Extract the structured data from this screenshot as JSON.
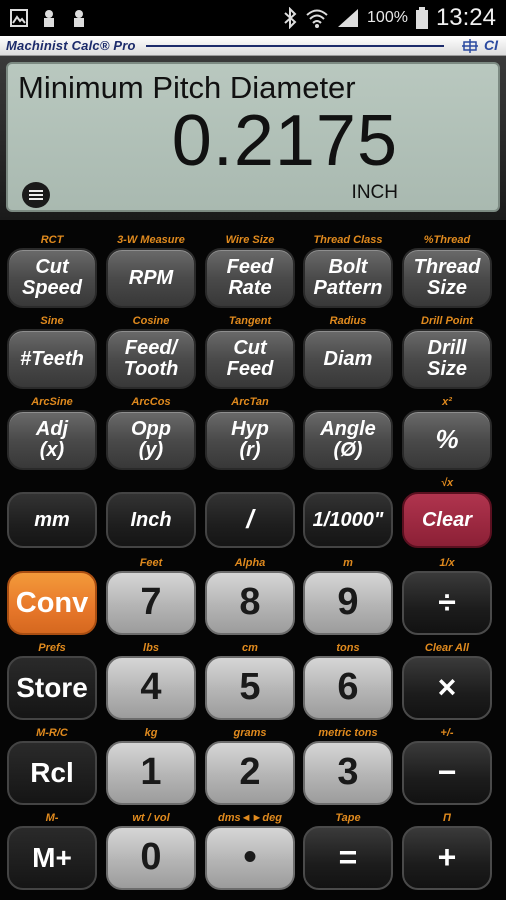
{
  "status_bar": {
    "battery_pct": "100%",
    "time": "13:24"
  },
  "app": {
    "title": "Machinist Calc® Pro",
    "brand": "CI"
  },
  "display": {
    "label": "Minimum Pitch Diameter",
    "value": "0.2175",
    "unit": "INCH"
  },
  "keys": {
    "cut_speed": {
      "label": "Cut\nSpeed",
      "sub": "RCT"
    },
    "rpm": {
      "label": "RPM",
      "sub": "3-W Measure"
    },
    "feed_rate": {
      "label": "Feed\nRate",
      "sub": "Wire Size"
    },
    "bolt_pattern": {
      "label": "Bolt\nPattern",
      "sub": "Thread Class"
    },
    "thread_size": {
      "label": "Thread\nSize",
      "sub": "%Thread"
    },
    "teeth": {
      "label": "#Teeth",
      "sub": "Sine"
    },
    "feed_tooth": {
      "label": "Feed/\nTooth",
      "sub": "Cosine"
    },
    "cut_feed": {
      "label": "Cut\nFeed",
      "sub": "Tangent"
    },
    "diam": {
      "label": "Diam",
      "sub": "Radius"
    },
    "drill_size": {
      "label": "Drill\nSize",
      "sub": "Drill Point"
    },
    "adj": {
      "label": "Adj\n(x)",
      "sub": "ArcSine"
    },
    "opp": {
      "label": "Opp\n(y)",
      "sub": "ArcCos"
    },
    "hyp": {
      "label": "Hyp\n(r)",
      "sub": "ArcTan"
    },
    "angle": {
      "label": "Angle\n(Ø)",
      "sub": ""
    },
    "percent": {
      "label": "%",
      "sub": "x²"
    },
    "mm": {
      "label": "mm",
      "sub": ""
    },
    "inch": {
      "label": "Inch",
      "sub": ""
    },
    "slash": {
      "label": "/",
      "sub": ""
    },
    "thousandth": {
      "label": "1/1000\"",
      "sub": ""
    },
    "clear": {
      "label": "Clear",
      "sub": "√x"
    },
    "conv": {
      "label": "Conv",
      "sub": ""
    },
    "n7": {
      "label": "7",
      "sub": "Feet"
    },
    "n8": {
      "label": "8",
      "sub": "Alpha"
    },
    "n9": {
      "label": "9",
      "sub": "m"
    },
    "divide": {
      "label": "÷",
      "sub": "1/x"
    },
    "store": {
      "label": "Store",
      "sub": "Prefs"
    },
    "n4": {
      "label": "4",
      "sub": "lbs"
    },
    "n5": {
      "label": "5",
      "sub": "cm"
    },
    "n6": {
      "label": "6",
      "sub": "tons"
    },
    "multiply": {
      "label": "×",
      "sub": "Clear All"
    },
    "rcl": {
      "label": "Rcl",
      "sub": "M-R/C"
    },
    "n1": {
      "label": "1",
      "sub": "kg"
    },
    "n2": {
      "label": "2",
      "sub": "grams"
    },
    "n3": {
      "label": "3",
      "sub": "metric tons"
    },
    "minus": {
      "label": "−",
      "sub": "+/-"
    },
    "mplus": {
      "label": "M+",
      "sub": "M-"
    },
    "n0": {
      "label": "0",
      "sub": "wt / vol"
    },
    "dot": {
      "label": "•",
      "sub": "dms◄►deg"
    },
    "equals": {
      "label": "=",
      "sub": "Tape"
    },
    "plus": {
      "label": "+",
      "sub": "Π"
    }
  }
}
